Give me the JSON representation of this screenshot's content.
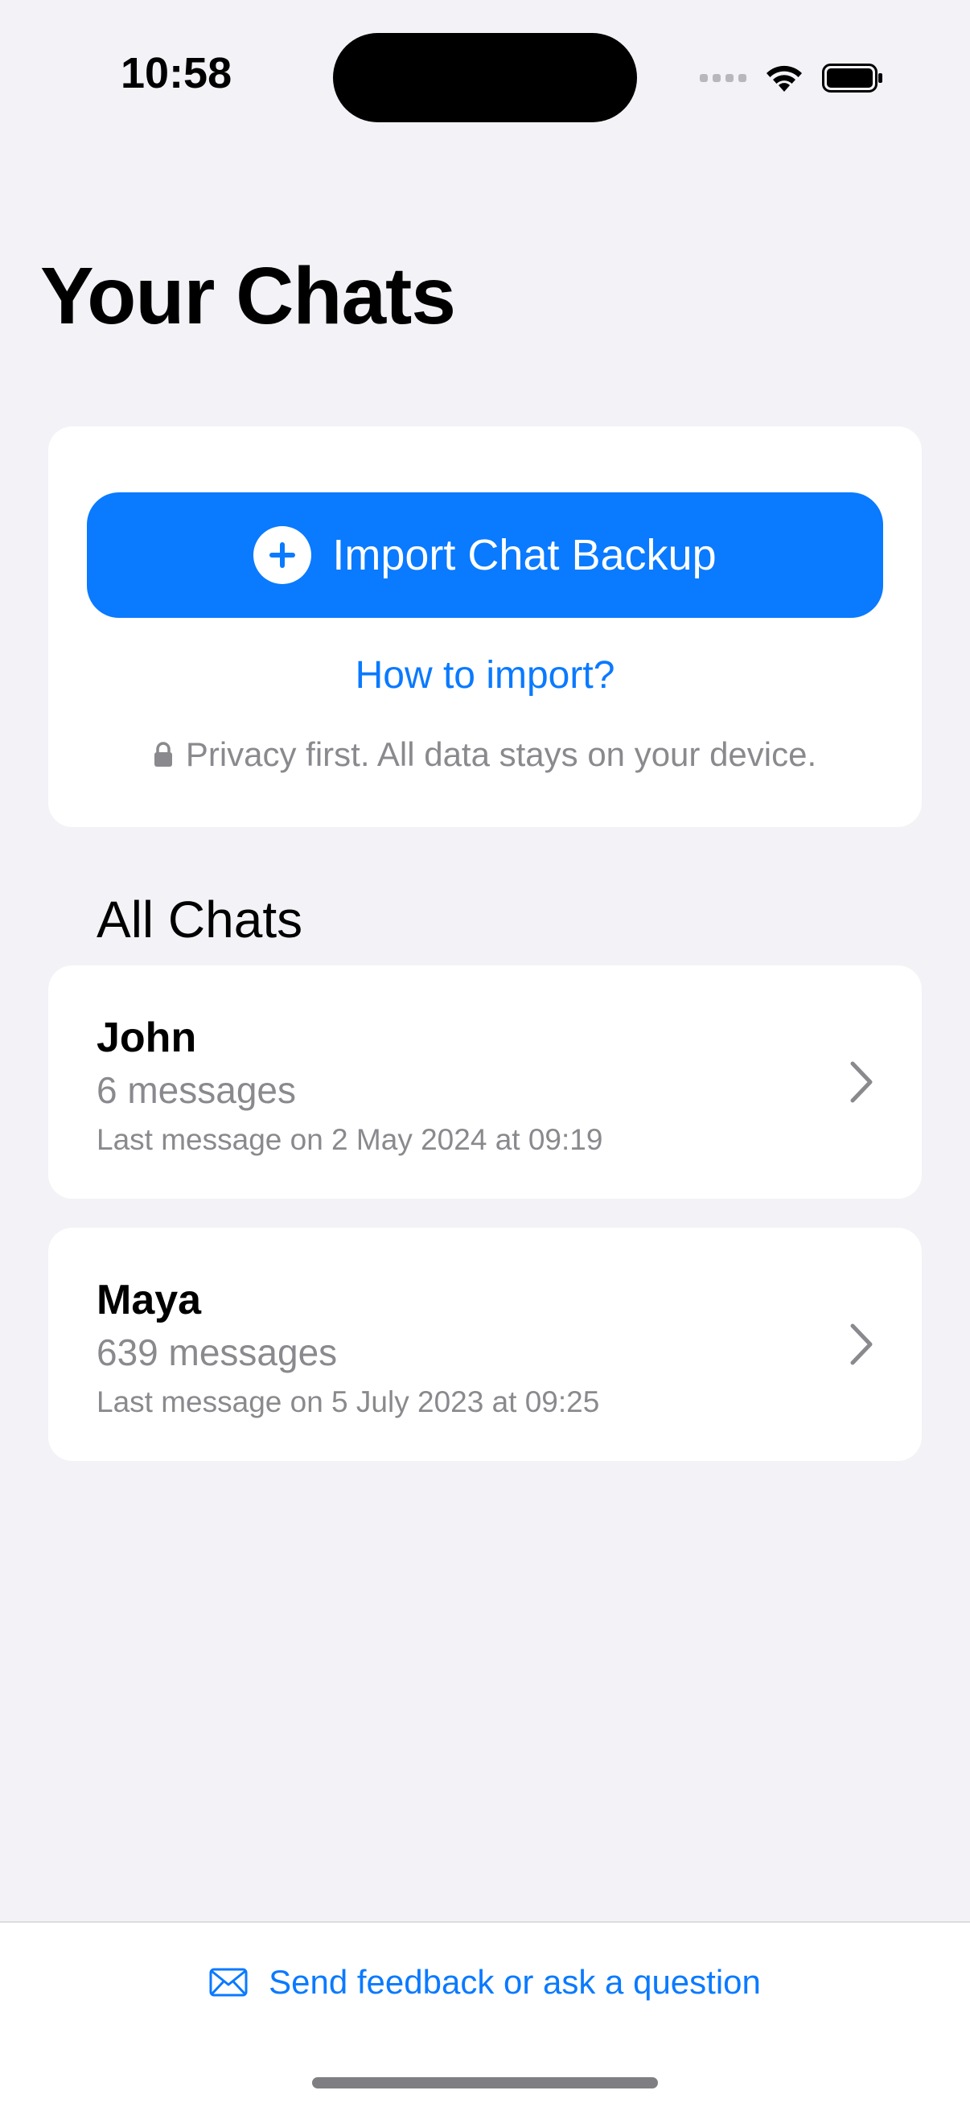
{
  "status_bar": {
    "time": "10:58"
  },
  "page": {
    "title": "Your Chats"
  },
  "import_card": {
    "import_button_label": "Import Chat Backup",
    "how_to_import_label": "How to import?",
    "privacy_text": "Privacy first. All data stays on your device."
  },
  "all_chats": {
    "header": "All Chats",
    "items": [
      {
        "name": "John",
        "count": "6 messages",
        "last": "Last message on 2 May 2024 at 09:19"
      },
      {
        "name": "Maya",
        "count": "639 messages",
        "last": "Last message on 5 July 2023 at 09:25"
      }
    ]
  },
  "footer": {
    "feedback_label": "Send feedback or ask a question"
  },
  "colors": {
    "accent": "#0A7AFF",
    "background": "#F2F2F7",
    "card": "#FFFFFF",
    "secondary_text": "#8A8A8E"
  }
}
